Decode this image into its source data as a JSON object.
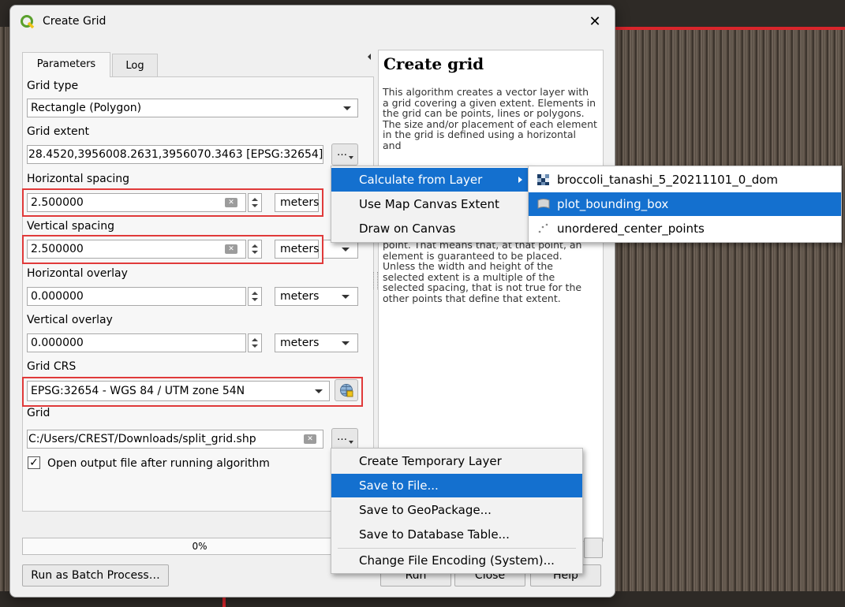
{
  "window": {
    "title": "Create Grid",
    "close_glyph": "✕"
  },
  "tabs": [
    {
      "label": "Parameters"
    },
    {
      "label": "Log"
    }
  ],
  "params": {
    "grid_type": {
      "label": "Grid type",
      "value": "Rectangle (Polygon)"
    },
    "grid_extent": {
      "label": "Grid extent",
      "value": "28.4520,3956008.2631,3956070.3463 [EPSG:32654]"
    },
    "h_spacing": {
      "label": "Horizontal spacing",
      "value": "2.500000",
      "unit": "meters"
    },
    "v_spacing": {
      "label": "Vertical spacing",
      "value": "2.500000",
      "unit": "meters"
    },
    "h_overlay": {
      "label": "Horizontal overlay",
      "value": "0.000000",
      "unit": "meters"
    },
    "v_overlay": {
      "label": "Vertical overlay",
      "value": "0.000000",
      "unit": "meters"
    },
    "crs": {
      "label": "Grid CRS",
      "value": "EPSG:32654 - WGS 84 / UTM zone 54N"
    },
    "grid": {
      "label": "Grid",
      "value": "C:/Users/CREST/Downloads/split_grid.shp"
    },
    "open_output": {
      "label": "Open output file after running algorithm",
      "checked": true
    }
  },
  "dots_label": "…",
  "help": {
    "title": "Create grid",
    "para1": "This algorithm creates a vector layer with a grid covering a given extent. Elements in the grid can be points, lines or polygons. The size and/or placement of each element in the grid is defined using a horizontal and",
    "para2": "point. That means that, at that point, an element is guaranteed to be placed. Unless the width and height of the selected extent is a multiple of the selected spacing, that is not true for the other points that define that extent."
  },
  "extent_menu": {
    "items": [
      {
        "label": "Calculate from Layer",
        "selected": true
      },
      {
        "label": "Use Map Canvas Extent"
      },
      {
        "label": "Draw on Canvas"
      }
    ]
  },
  "layer_submenu": {
    "items": [
      {
        "label": "broccoli_tanashi_5_20211101_0_dom",
        "icon": "raster-layer-icon"
      },
      {
        "label": "plot_bounding_box",
        "icon": "polygon-layer-icon",
        "selected": true
      },
      {
        "label": "unordered_center_points",
        "icon": "point-layer-icon"
      }
    ]
  },
  "output_menu": {
    "items": [
      {
        "label": "Create Temporary Layer"
      },
      {
        "label": "Save to File...",
        "selected": true
      },
      {
        "label": "Save to GeoPackage..."
      },
      {
        "label": "Save to Database Table..."
      },
      {
        "label": "Change File Encoding (System)..."
      }
    ]
  },
  "progress": {
    "label": "0%",
    "value": 0
  },
  "footer": {
    "batch": "Run as Batch Process…",
    "run": "Run",
    "close": "Close",
    "help": "Help"
  },
  "colors": {
    "accent": "#1470cf",
    "highlight_box": "#e03a3a"
  }
}
